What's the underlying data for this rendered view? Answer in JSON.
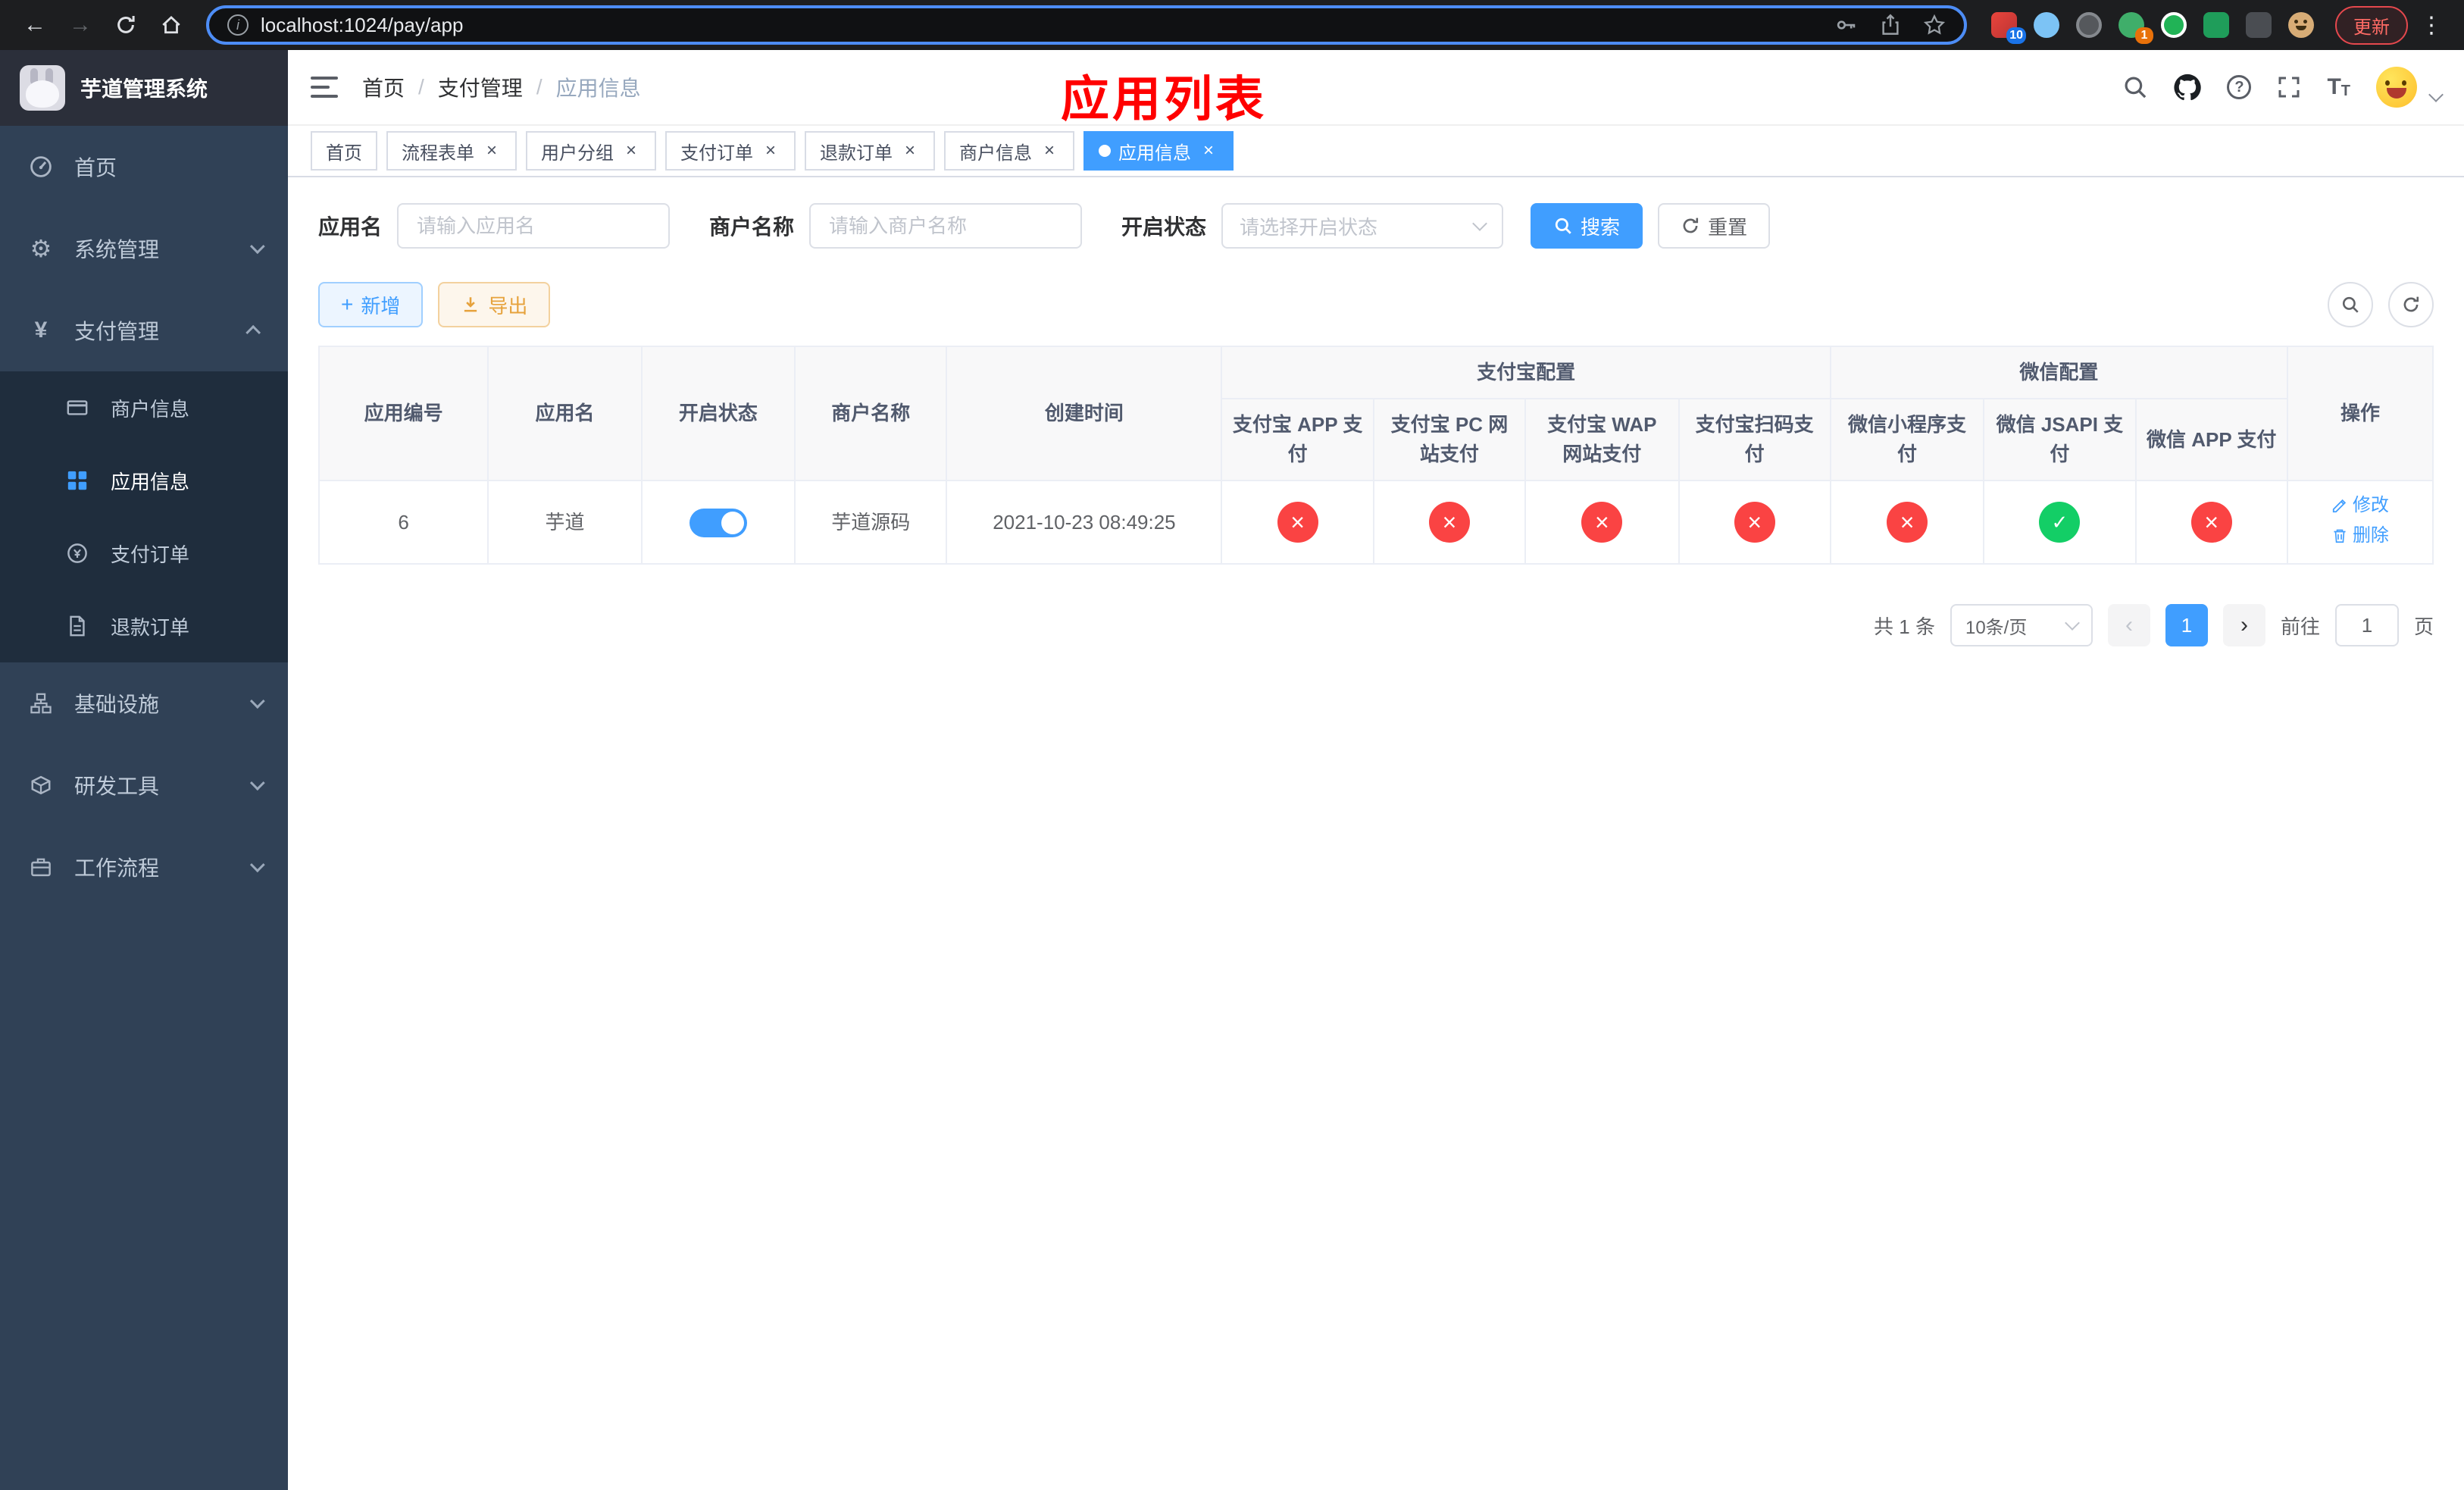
{
  "browser": {
    "url": "localhost:1024/pay/app",
    "update_label": "更新",
    "ext_badge_10": "10",
    "ext_badge_1": "1"
  },
  "sidebar": {
    "title": "芋道管理系统",
    "items": [
      {
        "label": "首页"
      },
      {
        "label": "系统管理"
      },
      {
        "label": "支付管理"
      },
      {
        "label": "基础设施"
      },
      {
        "label": "研发工具"
      },
      {
        "label": "工作流程"
      }
    ],
    "payment_children": [
      {
        "label": "商户信息"
      },
      {
        "label": "应用信息"
      },
      {
        "label": "支付订单"
      },
      {
        "label": "退款订单"
      }
    ]
  },
  "navbar": {
    "breadcrumb": {
      "home": "首页",
      "section": "支付管理",
      "current": "应用信息"
    },
    "annotation": "应用列表"
  },
  "tabs": {
    "items": [
      {
        "label": "首页"
      },
      {
        "label": "流程表单"
      },
      {
        "label": "用户分组"
      },
      {
        "label": "支付订单"
      },
      {
        "label": "退款订单"
      },
      {
        "label": "商户信息"
      },
      {
        "label": "应用信息"
      }
    ]
  },
  "filters": {
    "app_name": {
      "label": "应用名",
      "placeholder": "请输入应用名",
      "value": ""
    },
    "merchant_name": {
      "label": "商户名称",
      "placeholder": "请输入商户名称",
      "value": ""
    },
    "status": {
      "label": "开启状态",
      "placeholder": "请选择开启状态"
    },
    "search": "搜索",
    "reset": "重置"
  },
  "toolbar": {
    "add": "新增",
    "export": "导出"
  },
  "table": {
    "headers": {
      "app_id": "应用编号",
      "app_name": "应用名",
      "status": "开启状态",
      "merchant": "商户名称",
      "created": "创建时间",
      "alipay_group": "支付宝配置",
      "wechat_group": "微信配置",
      "alipay_app": "支付宝 APP 支付",
      "alipay_pc": "支付宝 PC 网站支付",
      "alipay_wap": "支付宝 WAP 网站支付",
      "alipay_qr": "支付宝扫码支付",
      "wechat_mini": "微信小程序支付",
      "wechat_jsapi": "微信 JSAPI 支付",
      "wechat_app": "微信 APP 支付",
      "actions": "操作"
    },
    "rows": [
      {
        "app_id": "6",
        "app_name": "芋道",
        "enabled": true,
        "merchant": "芋道源码",
        "created": "2021-10-23 08:49:25",
        "alipay_app": false,
        "alipay_pc": false,
        "alipay_wap": false,
        "alipay_qr": false,
        "wechat_mini": false,
        "wechat_jsapi": true,
        "wechat_app": false,
        "edit": "修改",
        "delete": "删除"
      }
    ],
    "status_colors": {
      "on": "#13ce66",
      "off": "#fa4343",
      "toggle": "#409eff"
    }
  },
  "pagination": {
    "total": "共 1 条",
    "page_size": "10条/页",
    "page": "1",
    "goto": "前往",
    "goto_value": "1",
    "unit": "页"
  }
}
